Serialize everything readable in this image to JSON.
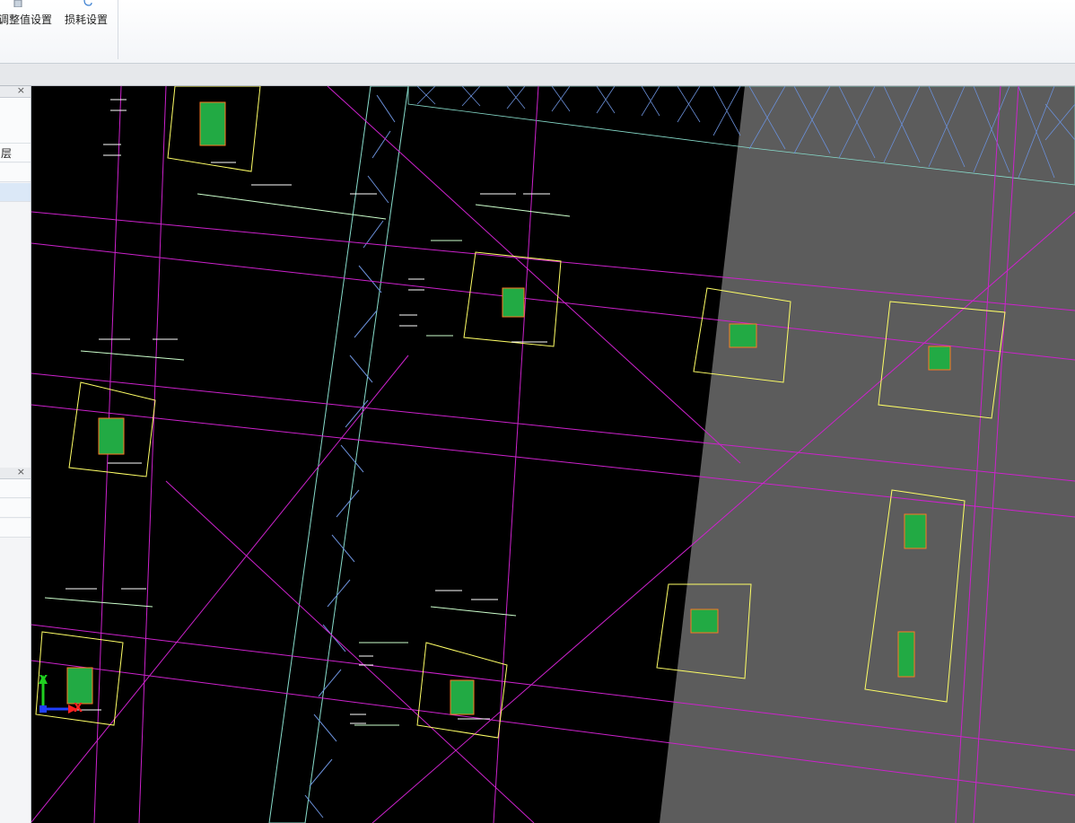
{
  "ribbon": {
    "buttons": [
      {
        "label": "调整值设置",
        "icon": "adjust-settings-icon"
      },
      {
        "label": "损耗设置",
        "icon": "loss-settings-icon"
      }
    ]
  },
  "left_panel": {
    "close_symbol": "×",
    "rows": [
      {
        "label": ""
      },
      {
        "label": "层"
      },
      {
        "label": ""
      },
      {
        "label": ""
      }
    ]
  },
  "canvas": {
    "background": "#000000",
    "slab_fill": "#5c5c5c",
    "grid_color": "#cc22cc",
    "column_outline": "#ffff66",
    "dimension_color": "#ccffcc",
    "hatch_color": "#66aadd",
    "axis": {
      "x": "X",
      "y": "Y"
    }
  },
  "colors": {
    "x_axis": "#ff2020",
    "y_axis": "#20d020",
    "panel_bg": "#f4f5f7"
  }
}
